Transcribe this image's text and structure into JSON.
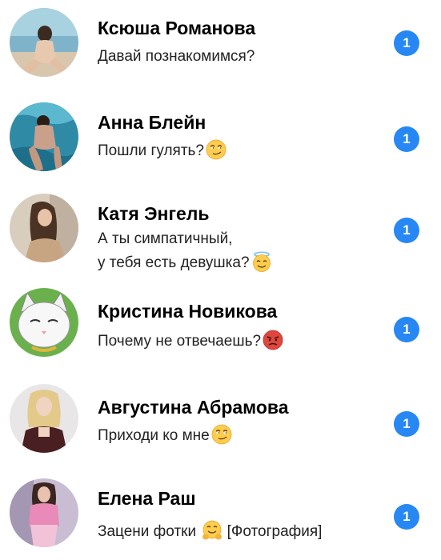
{
  "colors": {
    "badge": "#2787f5",
    "name": "#000000",
    "message": "#222222"
  },
  "chats": [
    {
      "name": "Ксюша Романова",
      "message_lines": [
        "Давай познакомимся?"
      ],
      "emoji": "",
      "suffix": "",
      "unread": "1",
      "avatar": "woman-on-beach-photo"
    },
    {
      "name": "Анна Блейн",
      "message_lines": [
        "Пошли гулять?"
      ],
      "emoji": "smirking-face-emoji",
      "suffix": "",
      "unread": "1",
      "avatar": "woman-in-water-photo"
    },
    {
      "name": "Катя Энгель",
      "message_lines": [
        "А ты симпатичный,",
        "у тебя есть девушка?"
      ],
      "emoji": "smiling-face-with-halo-emoji",
      "suffix": "",
      "unread": "1",
      "avatar": "woman-portrait-photo"
    },
    {
      "name": "Кристина Новикова",
      "message_lines": [
        "Почему не отвечаешь?"
      ],
      "emoji": "angry-face-emoji",
      "suffix": "",
      "unread": "1",
      "avatar": "white-cat-cartoon"
    },
    {
      "name": "Августина Абрамова",
      "message_lines": [
        "Приходи ко мне"
      ],
      "emoji": "smirking-face-emoji",
      "suffix": "",
      "unread": "1",
      "avatar": "blonde-woman-photo"
    },
    {
      "name": "Елена Раш",
      "message_lines": [
        "Зацени фотки"
      ],
      "emoji": "hugging-face-emoji",
      "suffix": "[Фотография]",
      "unread": "1",
      "avatar": "woman-in-pink-photo"
    }
  ]
}
